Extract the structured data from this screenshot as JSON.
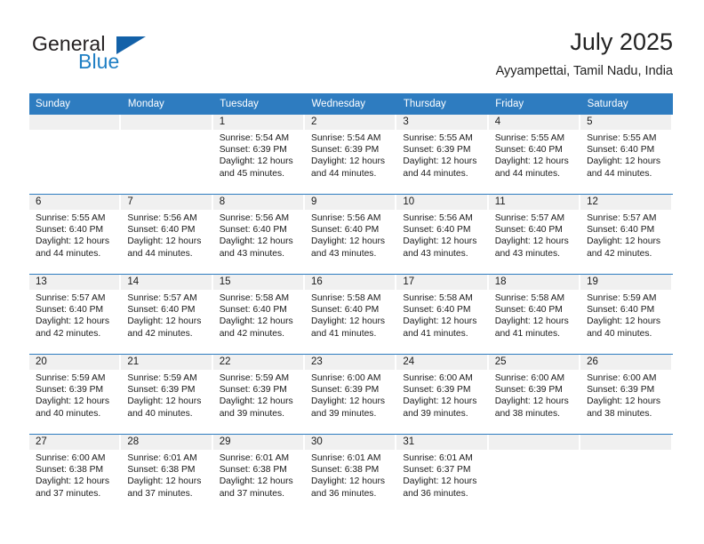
{
  "brand": {
    "word1": "General",
    "word2": "Blue",
    "flag_color": "#1361a8",
    "blue_color": "#1f7fc4"
  },
  "header": {
    "title": "July 2025",
    "subtitle": "Ayyampettai, Tamil Nadu, India",
    "accent_color": "#2e7cc0",
    "daynum_strip_color": "#f0f0f0"
  },
  "weekday_headers": [
    "Sunday",
    "Monday",
    "Tuesday",
    "Wednesday",
    "Thursday",
    "Friday",
    "Saturday"
  ],
  "labels": {
    "sunrise": "Sunrise:",
    "sunset": "Sunset:",
    "daylight": "Daylight:"
  },
  "weeks": [
    [
      {
        "day": "",
        "sunrise": "",
        "sunset": "",
        "daylight_line1": "",
        "daylight_line2": ""
      },
      {
        "day": "",
        "sunrise": "",
        "sunset": "",
        "daylight_line1": "",
        "daylight_line2": ""
      },
      {
        "day": "1",
        "sunrise": "Sunrise: 5:54 AM",
        "sunset": "Sunset: 6:39 PM",
        "daylight_line1": "Daylight: 12 hours",
        "daylight_line2": "and 45 minutes."
      },
      {
        "day": "2",
        "sunrise": "Sunrise: 5:54 AM",
        "sunset": "Sunset: 6:39 PM",
        "daylight_line1": "Daylight: 12 hours",
        "daylight_line2": "and 44 minutes."
      },
      {
        "day": "3",
        "sunrise": "Sunrise: 5:55 AM",
        "sunset": "Sunset: 6:39 PM",
        "daylight_line1": "Daylight: 12 hours",
        "daylight_line2": "and 44 minutes."
      },
      {
        "day": "4",
        "sunrise": "Sunrise: 5:55 AM",
        "sunset": "Sunset: 6:40 PM",
        "daylight_line1": "Daylight: 12 hours",
        "daylight_line2": "and 44 minutes."
      },
      {
        "day": "5",
        "sunrise": "Sunrise: 5:55 AM",
        "sunset": "Sunset: 6:40 PM",
        "daylight_line1": "Daylight: 12 hours",
        "daylight_line2": "and 44 minutes."
      }
    ],
    [
      {
        "day": "6",
        "sunrise": "Sunrise: 5:55 AM",
        "sunset": "Sunset: 6:40 PM",
        "daylight_line1": "Daylight: 12 hours",
        "daylight_line2": "and 44 minutes."
      },
      {
        "day": "7",
        "sunrise": "Sunrise: 5:56 AM",
        "sunset": "Sunset: 6:40 PM",
        "daylight_line1": "Daylight: 12 hours",
        "daylight_line2": "and 44 minutes."
      },
      {
        "day": "8",
        "sunrise": "Sunrise: 5:56 AM",
        "sunset": "Sunset: 6:40 PM",
        "daylight_line1": "Daylight: 12 hours",
        "daylight_line2": "and 43 minutes."
      },
      {
        "day": "9",
        "sunrise": "Sunrise: 5:56 AM",
        "sunset": "Sunset: 6:40 PM",
        "daylight_line1": "Daylight: 12 hours",
        "daylight_line2": "and 43 minutes."
      },
      {
        "day": "10",
        "sunrise": "Sunrise: 5:56 AM",
        "sunset": "Sunset: 6:40 PM",
        "daylight_line1": "Daylight: 12 hours",
        "daylight_line2": "and 43 minutes."
      },
      {
        "day": "11",
        "sunrise": "Sunrise: 5:57 AM",
        "sunset": "Sunset: 6:40 PM",
        "daylight_line1": "Daylight: 12 hours",
        "daylight_line2": "and 43 minutes."
      },
      {
        "day": "12",
        "sunrise": "Sunrise: 5:57 AM",
        "sunset": "Sunset: 6:40 PM",
        "daylight_line1": "Daylight: 12 hours",
        "daylight_line2": "and 42 minutes."
      }
    ],
    [
      {
        "day": "13",
        "sunrise": "Sunrise: 5:57 AM",
        "sunset": "Sunset: 6:40 PM",
        "daylight_line1": "Daylight: 12 hours",
        "daylight_line2": "and 42 minutes."
      },
      {
        "day": "14",
        "sunrise": "Sunrise: 5:57 AM",
        "sunset": "Sunset: 6:40 PM",
        "daylight_line1": "Daylight: 12 hours",
        "daylight_line2": "and 42 minutes."
      },
      {
        "day": "15",
        "sunrise": "Sunrise: 5:58 AM",
        "sunset": "Sunset: 6:40 PM",
        "daylight_line1": "Daylight: 12 hours",
        "daylight_line2": "and 42 minutes."
      },
      {
        "day": "16",
        "sunrise": "Sunrise: 5:58 AM",
        "sunset": "Sunset: 6:40 PM",
        "daylight_line1": "Daylight: 12 hours",
        "daylight_line2": "and 41 minutes."
      },
      {
        "day": "17",
        "sunrise": "Sunrise: 5:58 AM",
        "sunset": "Sunset: 6:40 PM",
        "daylight_line1": "Daylight: 12 hours",
        "daylight_line2": "and 41 minutes."
      },
      {
        "day": "18",
        "sunrise": "Sunrise: 5:58 AM",
        "sunset": "Sunset: 6:40 PM",
        "daylight_line1": "Daylight: 12 hours",
        "daylight_line2": "and 41 minutes."
      },
      {
        "day": "19",
        "sunrise": "Sunrise: 5:59 AM",
        "sunset": "Sunset: 6:40 PM",
        "daylight_line1": "Daylight: 12 hours",
        "daylight_line2": "and 40 minutes."
      }
    ],
    [
      {
        "day": "20",
        "sunrise": "Sunrise: 5:59 AM",
        "sunset": "Sunset: 6:39 PM",
        "daylight_line1": "Daylight: 12 hours",
        "daylight_line2": "and 40 minutes."
      },
      {
        "day": "21",
        "sunrise": "Sunrise: 5:59 AM",
        "sunset": "Sunset: 6:39 PM",
        "daylight_line1": "Daylight: 12 hours",
        "daylight_line2": "and 40 minutes."
      },
      {
        "day": "22",
        "sunrise": "Sunrise: 5:59 AM",
        "sunset": "Sunset: 6:39 PM",
        "daylight_line1": "Daylight: 12 hours",
        "daylight_line2": "and 39 minutes."
      },
      {
        "day": "23",
        "sunrise": "Sunrise: 6:00 AM",
        "sunset": "Sunset: 6:39 PM",
        "daylight_line1": "Daylight: 12 hours",
        "daylight_line2": "and 39 minutes."
      },
      {
        "day": "24",
        "sunrise": "Sunrise: 6:00 AM",
        "sunset": "Sunset: 6:39 PM",
        "daylight_line1": "Daylight: 12 hours",
        "daylight_line2": "and 39 minutes."
      },
      {
        "day": "25",
        "sunrise": "Sunrise: 6:00 AM",
        "sunset": "Sunset: 6:39 PM",
        "daylight_line1": "Daylight: 12 hours",
        "daylight_line2": "and 38 minutes."
      },
      {
        "day": "26",
        "sunrise": "Sunrise: 6:00 AM",
        "sunset": "Sunset: 6:39 PM",
        "daylight_line1": "Daylight: 12 hours",
        "daylight_line2": "and 38 minutes."
      }
    ],
    [
      {
        "day": "27",
        "sunrise": "Sunrise: 6:00 AM",
        "sunset": "Sunset: 6:38 PM",
        "daylight_line1": "Daylight: 12 hours",
        "daylight_line2": "and 37 minutes."
      },
      {
        "day": "28",
        "sunrise": "Sunrise: 6:01 AM",
        "sunset": "Sunset: 6:38 PM",
        "daylight_line1": "Daylight: 12 hours",
        "daylight_line2": "and 37 minutes."
      },
      {
        "day": "29",
        "sunrise": "Sunrise: 6:01 AM",
        "sunset": "Sunset: 6:38 PM",
        "daylight_line1": "Daylight: 12 hours",
        "daylight_line2": "and 37 minutes."
      },
      {
        "day": "30",
        "sunrise": "Sunrise: 6:01 AM",
        "sunset": "Sunset: 6:38 PM",
        "daylight_line1": "Daylight: 12 hours",
        "daylight_line2": "and 36 minutes."
      },
      {
        "day": "31",
        "sunrise": "Sunrise: 6:01 AM",
        "sunset": "Sunset: 6:37 PM",
        "daylight_line1": "Daylight: 12 hours",
        "daylight_line2": "and 36 minutes."
      },
      {
        "day": "",
        "sunrise": "",
        "sunset": "",
        "daylight_line1": "",
        "daylight_line2": ""
      },
      {
        "day": "",
        "sunrise": "",
        "sunset": "",
        "daylight_line1": "",
        "daylight_line2": ""
      }
    ]
  ]
}
